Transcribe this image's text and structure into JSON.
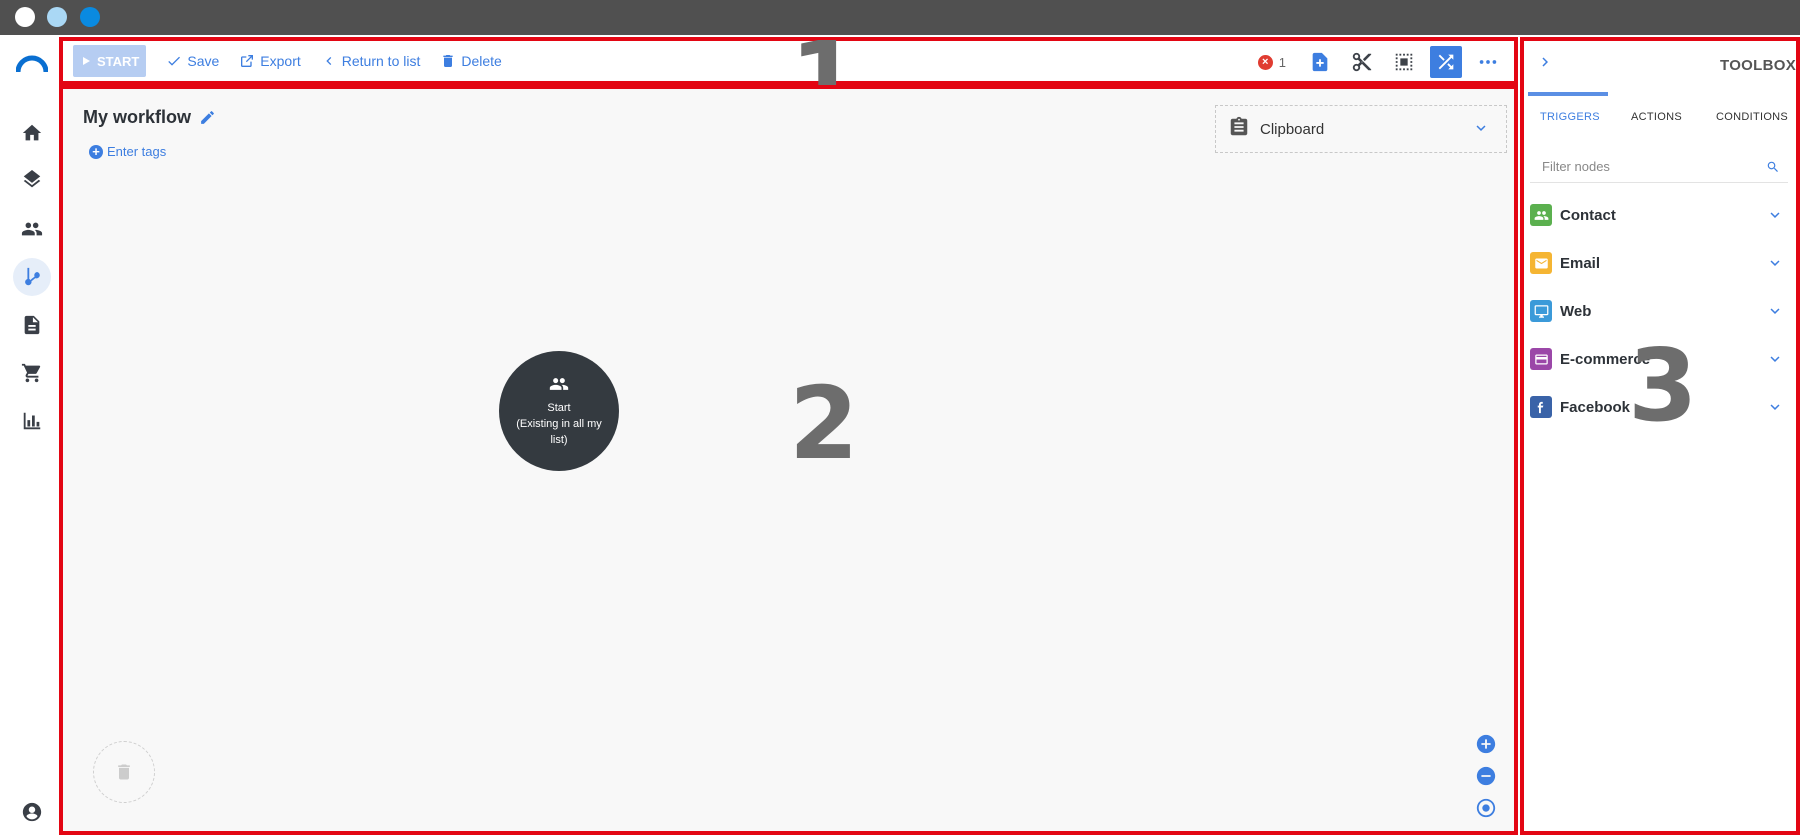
{
  "window": {
    "controls": [
      "close",
      "minimize",
      "maximize"
    ]
  },
  "leftnav": {
    "items": [
      {
        "icon": "home-icon"
      },
      {
        "icon": "layers-icon"
      },
      {
        "icon": "contacts-icon"
      },
      {
        "icon": "workflow-icon",
        "active": true
      },
      {
        "icon": "document-icon"
      },
      {
        "icon": "cart-icon"
      },
      {
        "icon": "chart-icon"
      }
    ],
    "account_icon": "account-icon"
  },
  "toolbar": {
    "start_label": "START",
    "save_label": "Save",
    "export_label": "Export",
    "return_label": "Return to list",
    "delete_label": "Delete",
    "error_count": "1",
    "region_number": "1"
  },
  "canvas": {
    "workflow_title": "My workflow",
    "tags_label": "Enter tags",
    "clipboard_label": "Clipboard",
    "start_node": {
      "title": "Start",
      "subtitle": "(Existing in all my list)"
    },
    "region_number": "2"
  },
  "toolbox": {
    "title": "TOOLBOX",
    "tabs": [
      "TRIGGERS",
      "ACTIONS",
      "CONDITIONS"
    ],
    "active_tab": "TRIGGERS",
    "filter_placeholder": "Filter nodes",
    "categories": [
      {
        "label": "Contact",
        "color": "#5bb04f",
        "icon": "contacts-icon"
      },
      {
        "label": "Email",
        "color": "#f5b533",
        "icon": "mail-icon"
      },
      {
        "label": "Web",
        "color": "#3b9ad9",
        "icon": "monitor-icon"
      },
      {
        "label": "E-commerce",
        "color": "#9b47a8",
        "icon": "card-icon"
      },
      {
        "label": "Facebook",
        "color": "#3a63a8",
        "icon": "facebook-icon"
      }
    ],
    "region_number": "3"
  },
  "colors": {
    "accent": "#3d7ee0",
    "frame": "#e30613",
    "titlebar": "#505050"
  }
}
